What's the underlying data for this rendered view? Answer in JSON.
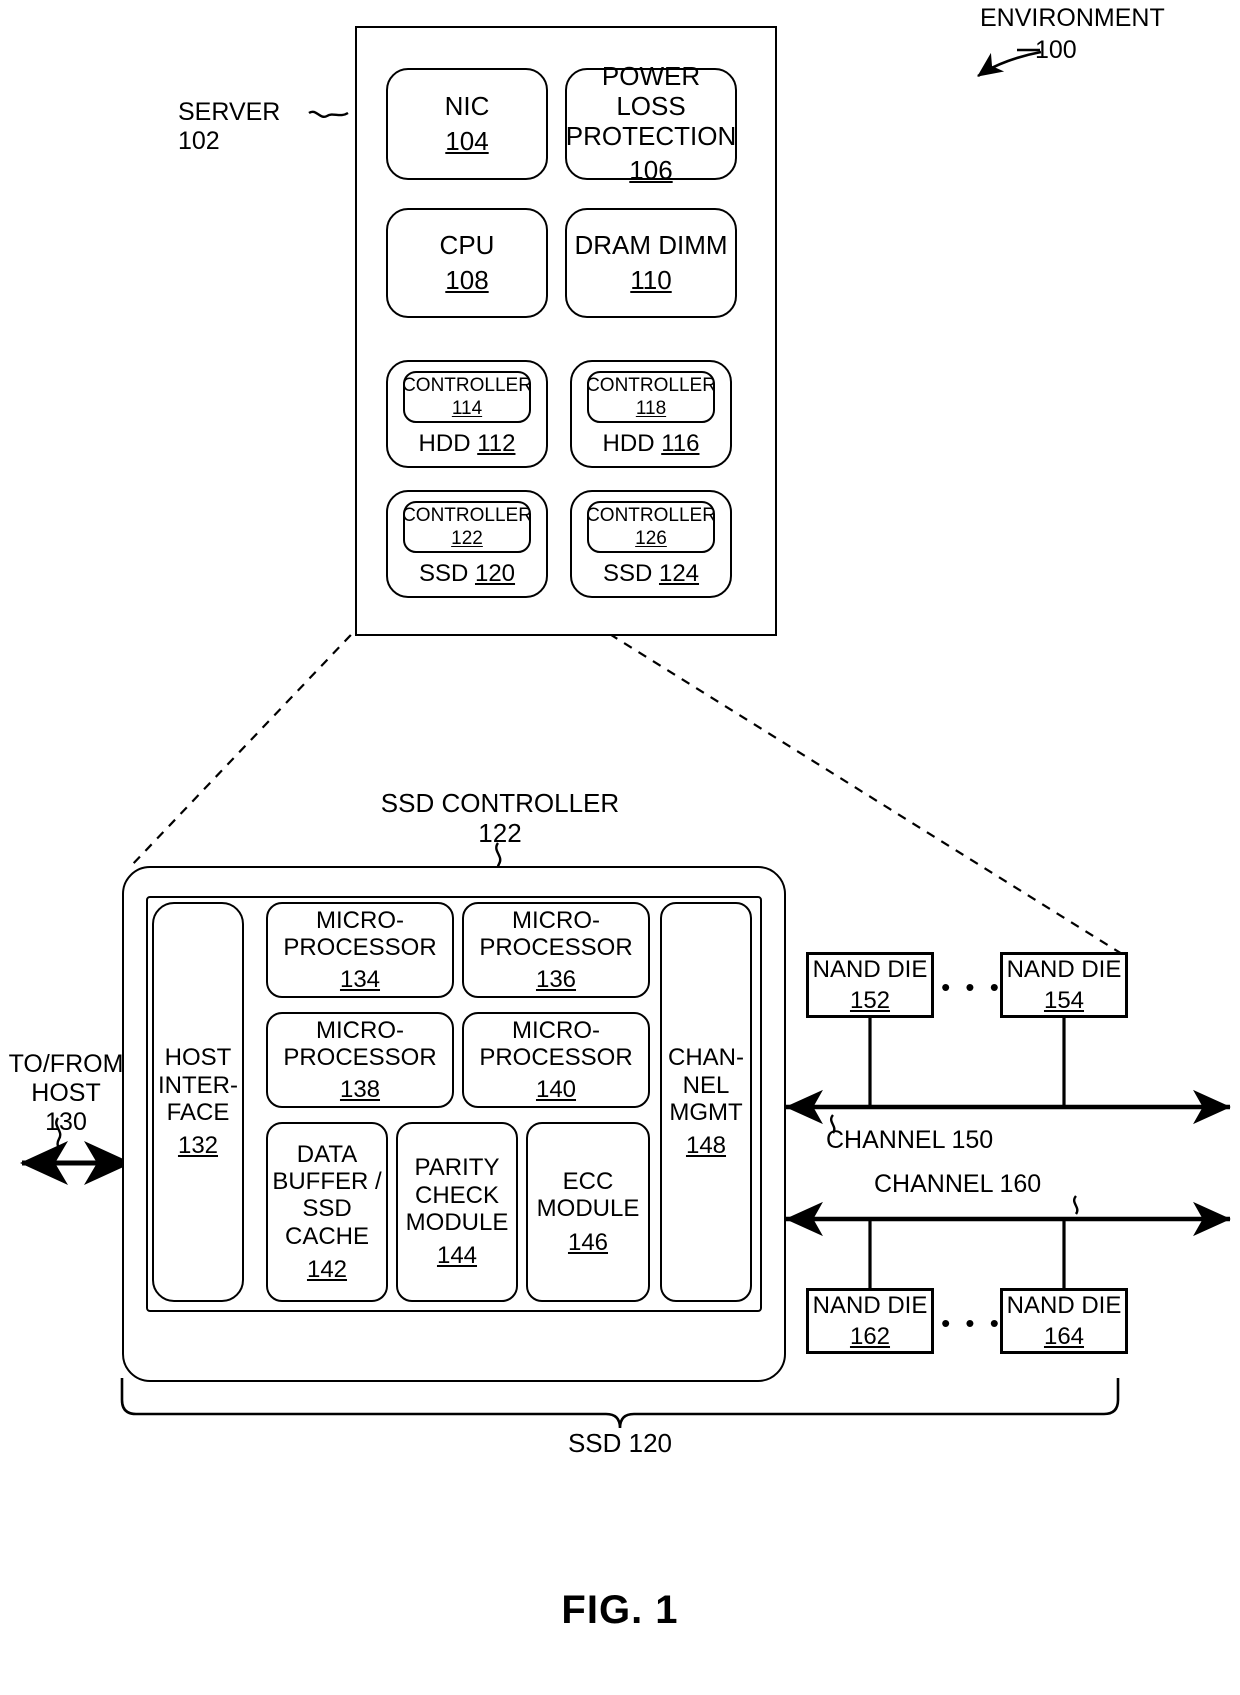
{
  "figure": {
    "caption": "FIG. 1",
    "environment_label": "ENVIRONMENT",
    "environment_number": "100"
  },
  "server": {
    "label": "SERVER 102",
    "components": [
      {
        "name": "NIC",
        "number": "104"
      },
      {
        "name": "POWER LOSS\nPROTECTION",
        "number": "106"
      },
      {
        "name": "CPU",
        "number": "108"
      },
      {
        "name": "DRAM DIMM",
        "number": "110"
      }
    ],
    "drives": [
      {
        "controller_label": "CONTROLLER",
        "controller_number": "114",
        "drive_label": "HDD",
        "drive_number": "112"
      },
      {
        "controller_label": "CONTROLLER",
        "controller_number": "118",
        "drive_label": "HDD",
        "drive_number": "116"
      },
      {
        "controller_label": "CONTROLLER",
        "controller_number": "122",
        "drive_label": "SSD",
        "drive_number": "120"
      },
      {
        "controller_label": "CONTROLLER",
        "controller_number": "126",
        "drive_label": "SSD",
        "drive_number": "124"
      }
    ]
  },
  "ssd_controller": {
    "title": "SSD CONTROLLER",
    "number": "122",
    "host_arrow_label": "TO/FROM\nHOST",
    "host_arrow_number": "130",
    "host_interface": {
      "name": "HOST\nINTER-\nFACE",
      "number": "132"
    },
    "microprocessors": [
      {
        "name": "MICRO-\nPROCESSOR",
        "number": "134"
      },
      {
        "name": "MICRO-\nPROCESSOR",
        "number": "136"
      },
      {
        "name": "MICRO-\nPROCESSOR",
        "number": "138"
      },
      {
        "name": "MICRO-\nPROCESSOR",
        "number": "140"
      }
    ],
    "modules": [
      {
        "name": "DATA\nBUFFER /\nSSD\nCACHE",
        "number": "142"
      },
      {
        "name": "PARITY\nCHECK\nMODULE",
        "number": "144"
      },
      {
        "name": "ECC\nMODULE",
        "number": "146"
      }
    ],
    "channel_mgmt": {
      "name": "CHAN-\nNEL\nMGMT",
      "number": "148"
    },
    "ssd_caption": "SSD 120"
  },
  "channels": [
    {
      "label": "CHANNEL 150",
      "dies": [
        {
          "name": "NAND DIE",
          "number": "152"
        },
        {
          "name": "NAND DIE",
          "number": "154"
        }
      ],
      "ellipsis": "• • •"
    },
    {
      "label": "CHANNEL 160",
      "dies": [
        {
          "name": "NAND DIE",
          "number": "162"
        },
        {
          "name": "NAND DIE",
          "number": "164"
        }
      ],
      "ellipsis": "• • •"
    }
  ]
}
